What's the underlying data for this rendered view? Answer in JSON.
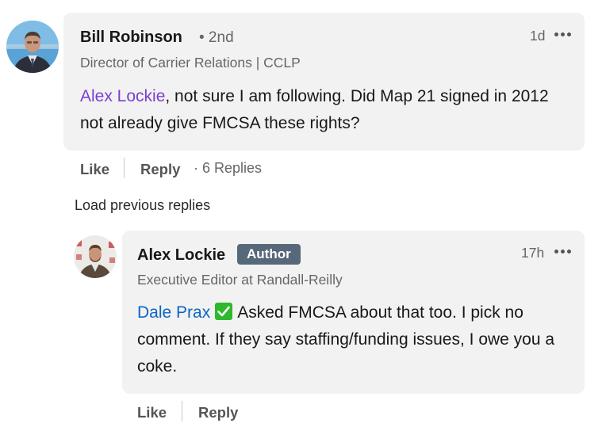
{
  "comment": {
    "author_name": "Bill Robinson",
    "degree": "• 2nd",
    "headline": "Director of Carrier Relations | CCLP",
    "time": "1d",
    "mention": "Alex Lockie",
    "text": ", not sure I am following. Did Map 21 signed in 2012 not already give FMCSA these rights?",
    "like_label": "Like",
    "reply_label": "Reply",
    "replies_count": "6 Replies"
  },
  "load_previous": "Load previous replies",
  "reply": {
    "author_name": "Alex Lockie",
    "badge": "Author",
    "headline": "Executive Editor at Randall-Reilly",
    "time": "17h",
    "mention": "Dale Prax",
    "text": "Asked FMCSA about that too. I pick no comment. If they say staffing/funding issues, I owe you a coke.",
    "like_label": "Like",
    "reply_label": "Reply"
  },
  "colors": {
    "mention_purple": "#7a3fd1",
    "mention_blue": "#0a66c2",
    "badge_bg": "#56687a",
    "bubble_bg": "#f2f2f2",
    "check_green": "#2eb82e"
  }
}
